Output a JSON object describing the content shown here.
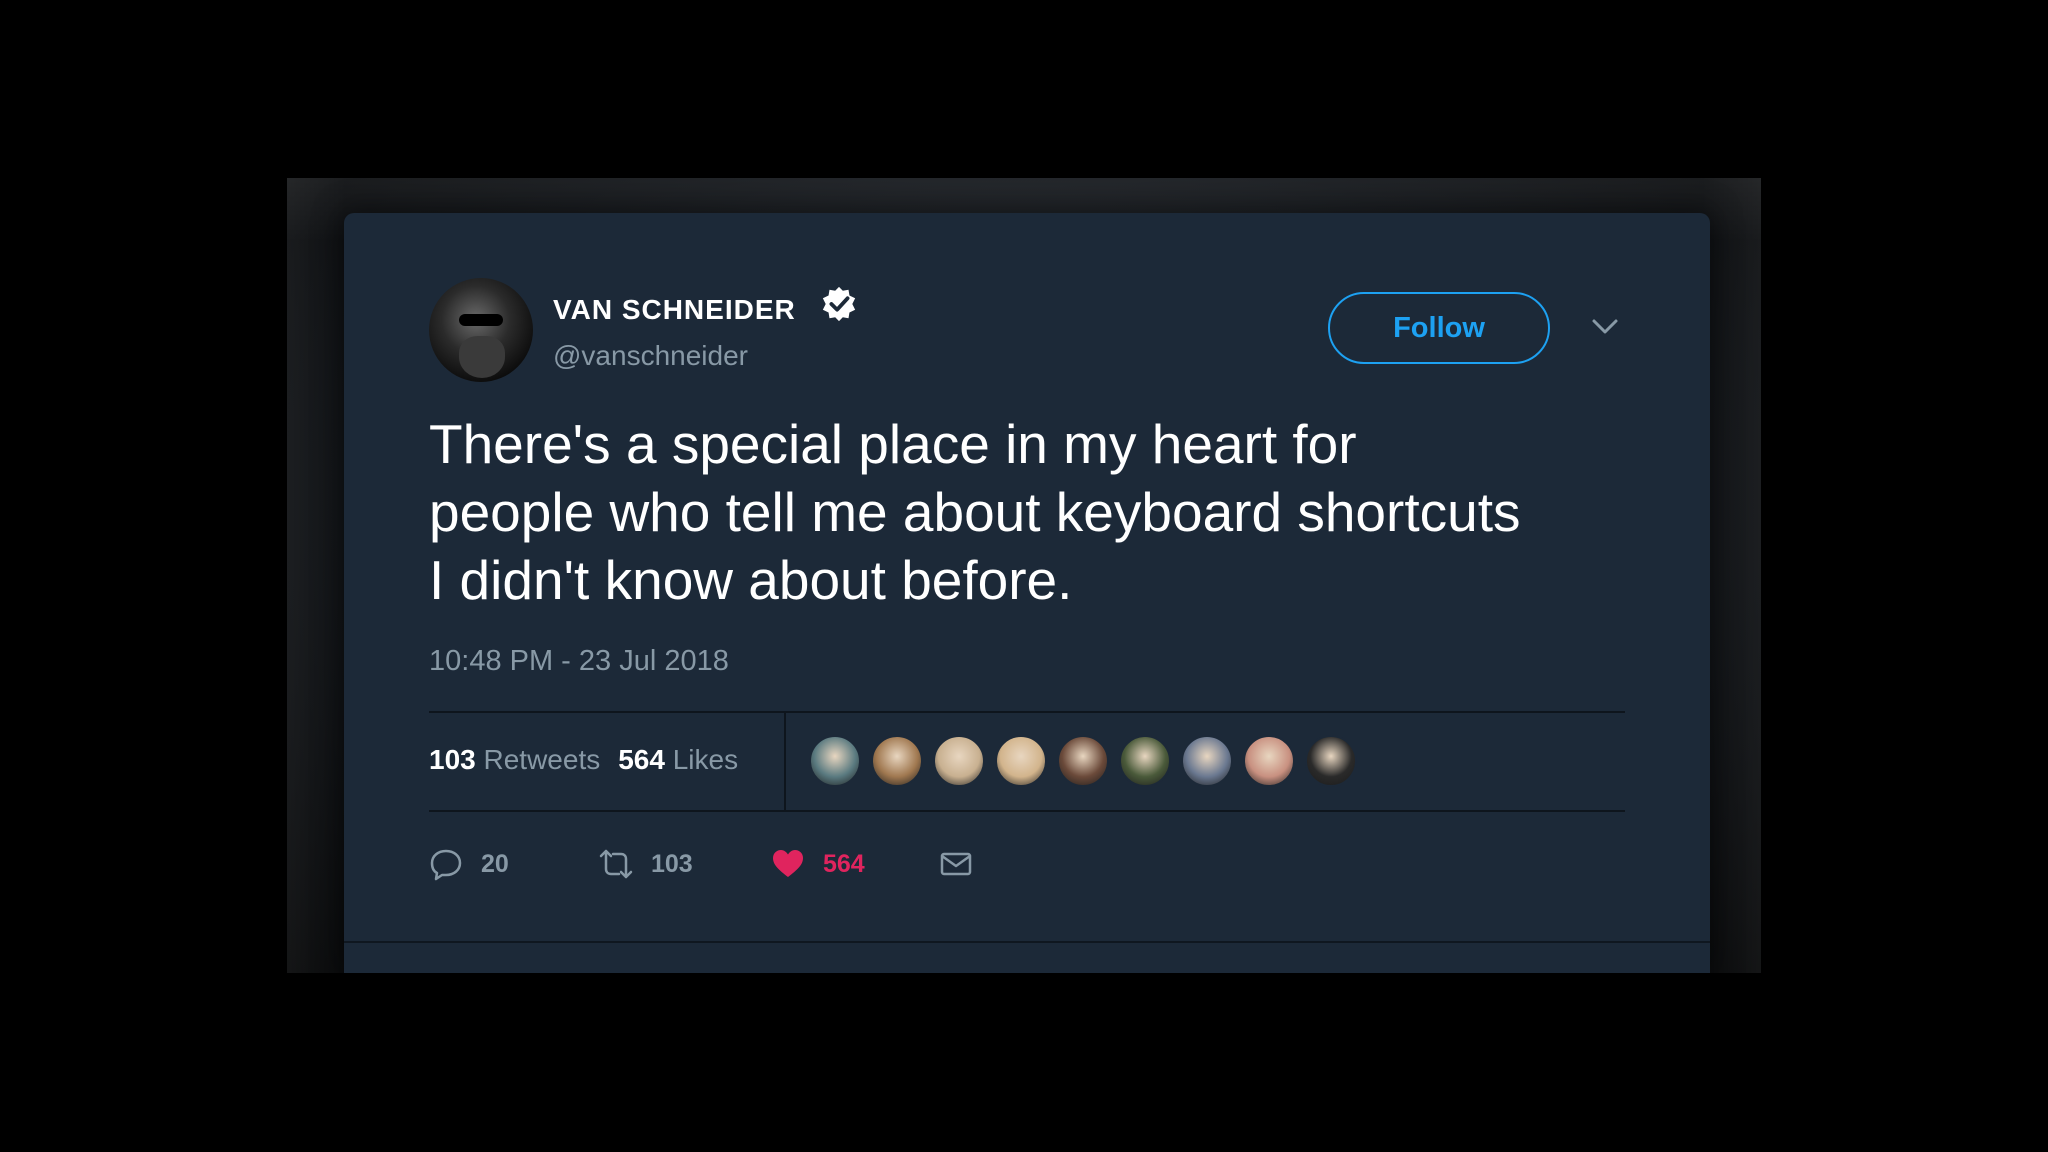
{
  "tweet": {
    "display_name": "VAN SCHNEIDER",
    "handle": "@vanschneider",
    "follow_label": "Follow",
    "text_line1": "There's a special place in my heart for",
    "text_line2": "people who tell me about keyboard shortcuts",
    "text_line3": "I didn't know about before.",
    "timestamp": "10:48 PM - 23 Jul 2018",
    "retweets_count": "103",
    "retweets_label": "Retweets",
    "likes_count": "564",
    "likes_label": "Likes",
    "actions": {
      "reply_count": "20",
      "retweet_count": "103",
      "like_count": "564"
    }
  },
  "liker_avatars": [
    "#5a7a80",
    "#a07850",
    "#c8b090",
    "#d2b48c",
    "#6b4a3a",
    "#4a5a3a",
    "#6a7890",
    "#c89080",
    "#2a2a2a"
  ],
  "colors": {
    "card_bg": "#1c2938",
    "accent": "#1da1f2",
    "like": "#e0245e",
    "secondary_text": "#8899a6"
  },
  "icons": [
    "verified-badge-icon",
    "chevron-down-icon",
    "reply-icon",
    "retweet-icon",
    "heart-icon",
    "mail-icon"
  ]
}
